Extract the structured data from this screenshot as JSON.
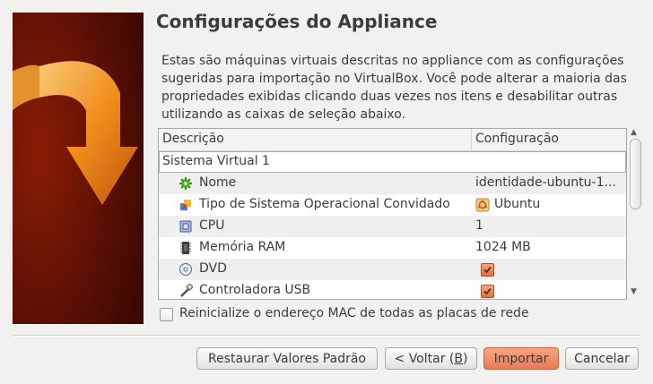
{
  "window": {
    "title": "Configurações do Appliance"
  },
  "intro": "Estas são máquinas virtuais descritas no appliance com as configurações sugeridas para importação no VirtualBox. Você pode alterar a maioria das propriedades exibidas clicando duas vezes nos itens e desabilitar outras utilizando as caixas de seleção abaixo.",
  "table": {
    "headers": {
      "description": "Descrição",
      "configuration": "Configuração"
    },
    "group_label": "Sistema Virtual 1",
    "rows": [
      {
        "label": "Nome",
        "value": "identidade-ubuntu-1...",
        "icon": "name-icon"
      },
      {
        "label": "Tipo de Sistema Operacional Convidado",
        "value": "Ubuntu",
        "icon": "os-type-icon"
      },
      {
        "label": "CPU",
        "value": "1",
        "icon": "cpu-icon"
      },
      {
        "label": "Memória RAM",
        "value": "1024 MB",
        "icon": "ram-icon"
      },
      {
        "label": "DVD",
        "value": "",
        "checked": true,
        "icon": "dvd-icon"
      },
      {
        "label": "Controladora USB",
        "value": "",
        "checked": true,
        "icon": "usb-icon"
      }
    ]
  },
  "reset_mac": {
    "label": "Reinicialize o endereço MAC de todas as placas de rede",
    "checked": false
  },
  "buttons": {
    "restore": "Restaurar Valores Padrão",
    "back_prefix": "< Voltar (",
    "back_key": "B",
    "back_suffix": ")",
    "import": "Importar",
    "cancel": "Cancelar"
  },
  "colors": {
    "accent": "#ea7a55",
    "banner_bg": "#5a1004"
  }
}
